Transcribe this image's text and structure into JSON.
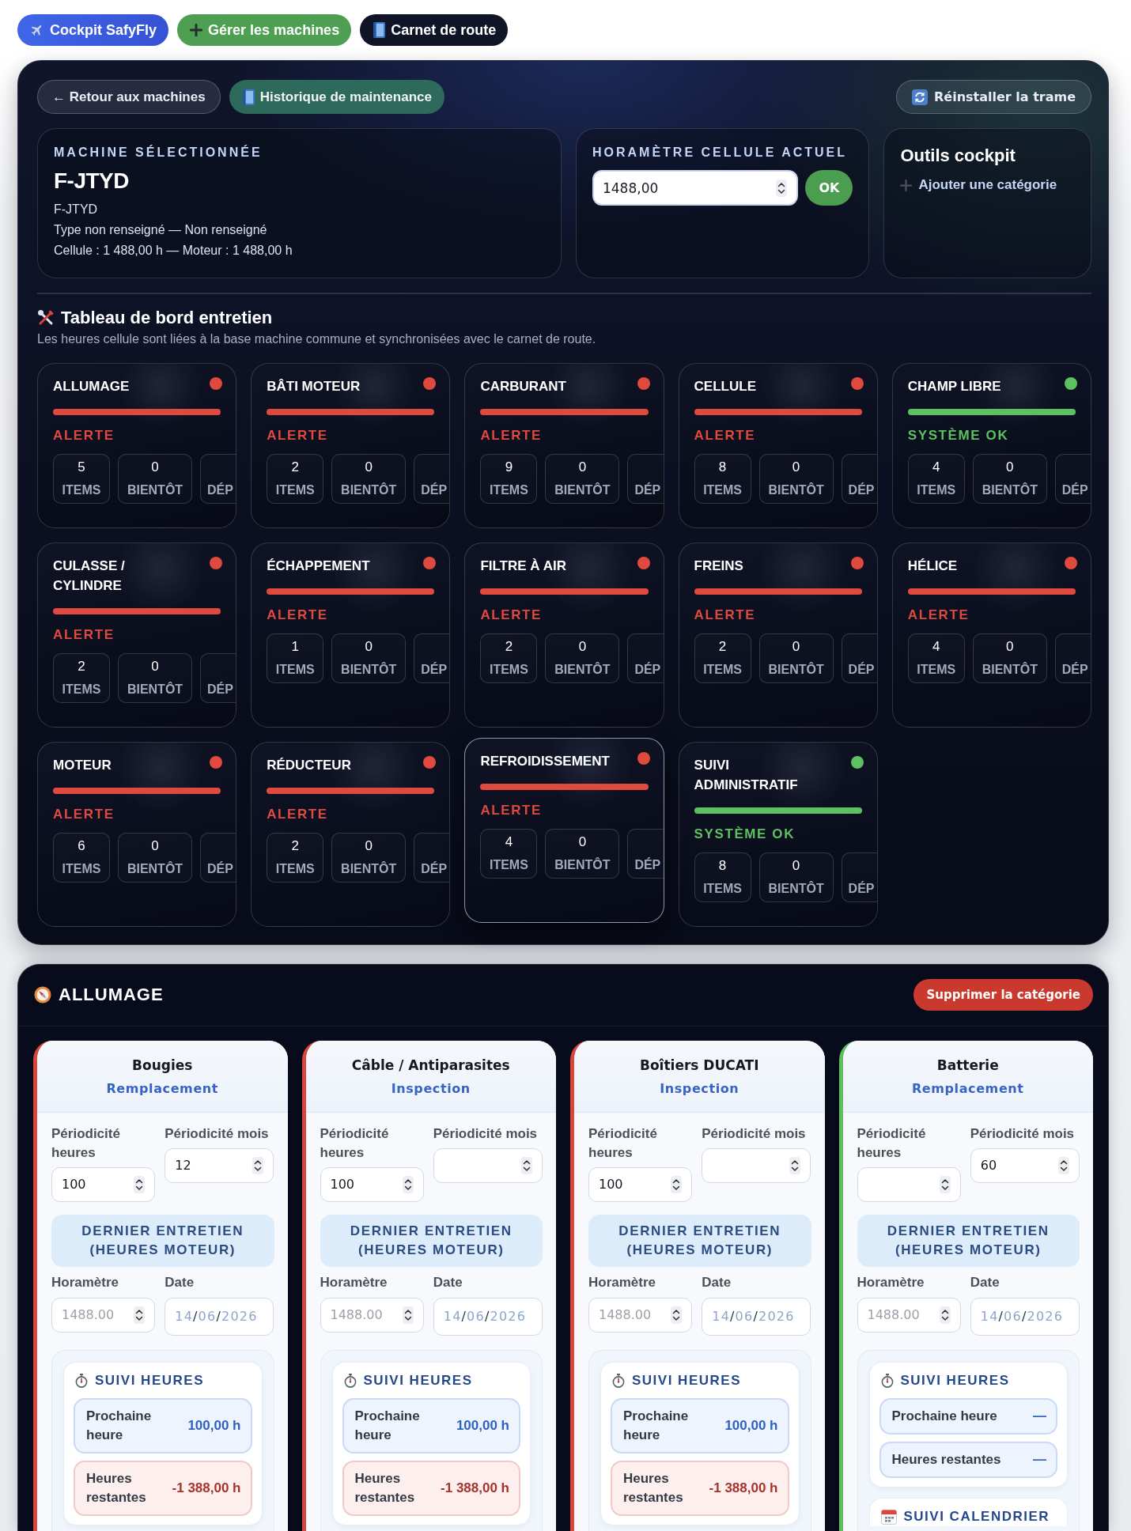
{
  "nav": [
    {
      "kind": "cockpit",
      "label": "Cockpit SafyFly"
    },
    {
      "kind": "add",
      "label": "Gérer les machines"
    },
    {
      "kind": "logbook",
      "label": "Carnet de route"
    }
  ],
  "toolbar": {
    "back": "← Retour aux machines",
    "history": "Historique de maintenance",
    "reset": "Réinstaller la trame"
  },
  "machine": {
    "heading": "MACHINE SÉLECTIONNÉE",
    "registration": "F-JTYD",
    "lines": [
      "F-JTYD",
      "Type non renseigné — Non renseigné",
      "Cellule : 1 488,00 h — Moteur : 1 488,00 h"
    ]
  },
  "hour_meter": {
    "heading": "HORAMÈTRE CELLULE ACTUEL",
    "value": "1488,00",
    "button": "OK"
  },
  "tools": {
    "title": "Outils cockpit",
    "add_link": "Ajouter une catégorie"
  },
  "dashboard": {
    "title": "Tableau de bord entretien",
    "subtitle": "Les heures cellule sont liées à la base machine commune et synchronisées avec le carnet de route.",
    "categories": [
      {
        "name": "ALLUMAGE",
        "kind": "alert",
        "status_label": "ALERTE",
        "hovered": false,
        "stats": [
          {
            "value": "5",
            "label": "ITEMS"
          },
          {
            "value": "0",
            "label": "BIENTÔT"
          },
          {
            "label": "DÉP"
          }
        ]
      },
      {
        "name": "BÂTI MOTEUR",
        "kind": "alert",
        "status_label": "ALERTE",
        "hovered": false,
        "stats": [
          {
            "value": "2",
            "label": "ITEMS"
          },
          {
            "value": "0",
            "label": "BIENTÔT"
          },
          {
            "label": "DÉP"
          }
        ]
      },
      {
        "name": "CARBURANT",
        "kind": "alert",
        "status_label": "ALERTE",
        "hovered": false,
        "stats": [
          {
            "value": "9",
            "label": "ITEMS"
          },
          {
            "value": "0",
            "label": "BIENTÔT"
          },
          {
            "label": "DÉP"
          }
        ]
      },
      {
        "name": "CELLULE",
        "kind": "alert",
        "status_label": "ALERTE",
        "hovered": false,
        "stats": [
          {
            "value": "8",
            "label": "ITEMS"
          },
          {
            "value": "0",
            "label": "BIENTÔT"
          },
          {
            "label": "DÉP"
          }
        ]
      },
      {
        "name": "CHAMP LIBRE",
        "kind": "ok",
        "status_label": "SYSTÈME OK",
        "hovered": false,
        "stats": [
          {
            "value": "4",
            "label": "ITEMS"
          },
          {
            "value": "0",
            "label": "BIENTÔT"
          },
          {
            "label": "DÉP"
          }
        ]
      },
      {
        "name": "CULASSE / CYLINDRE",
        "kind": "alert",
        "status_label": "ALERTE",
        "hovered": false,
        "stats": [
          {
            "value": "2",
            "label": "ITEMS"
          },
          {
            "value": "0",
            "label": "BIENTÔT"
          },
          {
            "label": "DÉP"
          }
        ]
      },
      {
        "name": "ÉCHAPPEMENT",
        "kind": "alert",
        "status_label": "ALERTE",
        "hovered": false,
        "stats": [
          {
            "value": "1",
            "label": "ITEMS"
          },
          {
            "value": "0",
            "label": "BIENTÔT"
          },
          {
            "label": "DÉP"
          }
        ]
      },
      {
        "name": "FILTRE À AIR",
        "kind": "alert",
        "status_label": "ALERTE",
        "hovered": false,
        "stats": [
          {
            "value": "2",
            "label": "ITEMS"
          },
          {
            "value": "0",
            "label": "BIENTÔT"
          },
          {
            "label": "DÉP"
          }
        ]
      },
      {
        "name": "FREINS",
        "kind": "alert",
        "status_label": "ALERTE",
        "hovered": false,
        "stats": [
          {
            "value": "2",
            "label": "ITEMS"
          },
          {
            "value": "0",
            "label": "BIENTÔT"
          },
          {
            "label": "DÉP"
          }
        ]
      },
      {
        "name": "HÉLICE",
        "kind": "alert",
        "status_label": "ALERTE",
        "hovered": false,
        "stats": [
          {
            "value": "4",
            "label": "ITEMS"
          },
          {
            "value": "0",
            "label": "BIENTÔT"
          },
          {
            "label": "DÉP"
          }
        ]
      },
      {
        "name": "MOTEUR",
        "kind": "alert",
        "status_label": "ALERTE",
        "hovered": false,
        "stats": [
          {
            "value": "6",
            "label": "ITEMS"
          },
          {
            "value": "0",
            "label": "BIENTÔT"
          },
          {
            "label": "DÉP"
          }
        ]
      },
      {
        "name": "RÉDUCTEUR",
        "kind": "alert",
        "status_label": "ALERTE",
        "hovered": false,
        "stats": [
          {
            "value": "2",
            "label": "ITEMS"
          },
          {
            "value": "0",
            "label": "BIENTÔT"
          },
          {
            "label": "DÉP"
          }
        ]
      },
      {
        "name": "REFROIDISSEMENT",
        "kind": "alert",
        "status_label": "ALERTE",
        "hovered": true,
        "stats": [
          {
            "value": "4",
            "label": "ITEMS"
          },
          {
            "value": "0",
            "label": "BIENTÔT"
          },
          {
            "label": "DÉP"
          }
        ]
      },
      {
        "name": "SUIVI ADMINISTRATIF",
        "kind": "ok",
        "status_label": "SYSTÈME OK",
        "hovered": false,
        "stats": [
          {
            "value": "8",
            "label": "ITEMS"
          },
          {
            "value": "0",
            "label": "BIENTÔT"
          },
          {
            "label": "DÉP"
          }
        ]
      }
    ]
  },
  "category_detail": {
    "title": "ALLUMAGE",
    "delete_button": "Supprimer la catégorie",
    "items": [
      {
        "name": "Bougies",
        "action": "Remplacement",
        "kind": "alert",
        "fields": [
          {
            "kind": "number",
            "label": "Périodicité heures",
            "value": "100"
          },
          {
            "kind": "number",
            "label": "Périodicité mois",
            "value": "12"
          }
        ],
        "last_service": {
          "heading": "DERNIER ENTRETIEN (HEURES MOTEUR)",
          "fields": [
            {
              "kind": "number",
              "label": "Horamètre",
              "placeholder": "1488.00"
            },
            {
              "kind": "date",
              "label": "Date",
              "value": "14/06/2026"
            }
          ]
        },
        "hours_tracking": {
          "title": "SUIVI HEURES",
          "rows": [
            {
              "label": "Prochaine heure",
              "value": "100,00 h",
              "kind": "info"
            },
            {
              "label": "Heures restantes",
              "value": "-1 388,00 h",
              "kind": "danger"
            }
          ]
        }
      },
      {
        "name": "Câble / Antiparasites",
        "action": "Inspection",
        "kind": "alert",
        "fields": [
          {
            "kind": "number",
            "label": "Périodicité heures",
            "value": "100"
          },
          {
            "kind": "number",
            "label": "Périodicité mois"
          }
        ],
        "last_service": {
          "heading": "DERNIER ENTRETIEN (HEURES MOTEUR)",
          "fields": [
            {
              "kind": "number",
              "label": "Horamètre",
              "placeholder": "1488.00"
            },
            {
              "kind": "date",
              "label": "Date",
              "value": "14/06/2026"
            }
          ]
        },
        "hours_tracking": {
          "title": "SUIVI HEURES",
          "rows": [
            {
              "label": "Prochaine heure",
              "value": "100,00 h",
              "kind": "info"
            },
            {
              "label": "Heures restantes",
              "value": "-1 388,00 h",
              "kind": "danger"
            }
          ]
        }
      },
      {
        "name": "Boîtiers DUCATI",
        "action": "Inspection",
        "kind": "alert",
        "fields": [
          {
            "kind": "number",
            "label": "Périodicité heures",
            "value": "100"
          },
          {
            "kind": "number",
            "label": "Périodicité mois"
          }
        ],
        "last_service": {
          "heading": "DERNIER ENTRETIEN (HEURES MOTEUR)",
          "fields": [
            {
              "kind": "number",
              "label": "Horamètre",
              "placeholder": "1488.00"
            },
            {
              "kind": "date",
              "label": "Date",
              "value": "14/06/2026"
            }
          ]
        },
        "hours_tracking": {
          "title": "SUIVI HEURES",
          "rows": [
            {
              "label": "Prochaine heure",
              "value": "100,00 h",
              "kind": "info"
            },
            {
              "label": "Heures restantes",
              "value": "-1 388,00 h",
              "kind": "danger"
            }
          ]
        }
      },
      {
        "name": "Batterie",
        "action": "Remplacement",
        "kind": "ok",
        "fields": [
          {
            "kind": "number",
            "label": "Périodicité heures"
          },
          {
            "kind": "number",
            "label": "Périodicité mois",
            "value": "60"
          }
        ],
        "last_service": {
          "heading": "DERNIER ENTRETIEN (HEURES MOTEUR)",
          "fields": [
            {
              "kind": "number",
              "label": "Horamètre",
              "placeholder": "1488.00"
            },
            {
              "kind": "date",
              "label": "Date",
              "value": "14/06/2026"
            }
          ]
        },
        "hours_tracking": {
          "title": "SUIVI HEURES",
          "rows": [
            {
              "label": "Prochaine heure",
              "value": "—",
              "kind": "info"
            },
            {
              "label": "Heures restantes",
              "value": "—",
              "kind": "info"
            }
          ]
        },
        "calendar_tracking": {
          "title": "SUIVI CALENDRIER"
        }
      }
    ]
  }
}
